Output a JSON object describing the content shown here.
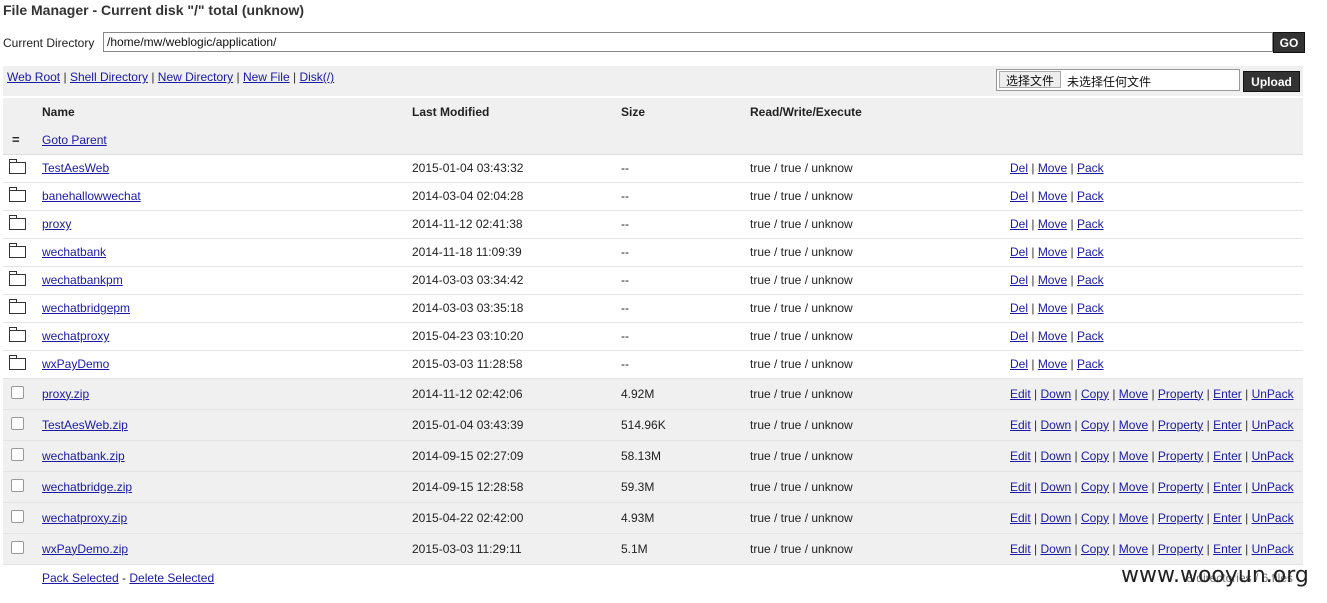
{
  "title": "File Manager - Current disk \"/\" total (unknow)",
  "current_directory": {
    "label": "Current Directory",
    "value": "/home/mw/weblogic/application/",
    "go_label": "GO"
  },
  "toolbar": {
    "links": [
      "Web Root",
      "Shell Directory",
      "New Directory",
      "New File",
      "Disk(/)"
    ],
    "choose_file_label": "选择文件",
    "no_file_text": "未选择任何文件",
    "upload_label": "Upload"
  },
  "table": {
    "headers": [
      "Name",
      "Last Modified",
      "Size",
      "Read/Write/Execute"
    ],
    "parent_symbol": "=",
    "parent_label": "Goto Parent",
    "dir_actions": [
      "Del",
      "Move",
      "Pack"
    ],
    "file_actions": [
      "Edit",
      "Down",
      "Copy",
      "Move",
      "Property",
      "Enter",
      "UnPack"
    ],
    "directories": [
      {
        "name": "TestAesWeb",
        "modified": "2015-01-04 03:43:32",
        "size": "--",
        "perms": "true / true / unknow"
      },
      {
        "name": "banehallowwechat",
        "modified": "2014-03-04 02:04:28",
        "size": "--",
        "perms": "true / true / unknow"
      },
      {
        "name": "proxy",
        "modified": "2014-11-12 02:41:38",
        "size": "--",
        "perms": "true / true / unknow"
      },
      {
        "name": "wechatbank",
        "modified": "2014-11-18 11:09:39",
        "size": "--",
        "perms": "true / true / unknow"
      },
      {
        "name": "wechatbankpm",
        "modified": "2014-03-03 03:34:42",
        "size": "--",
        "perms": "true / true / unknow"
      },
      {
        "name": "wechatbridgepm",
        "modified": "2014-03-03 03:35:18",
        "size": "--",
        "perms": "true / true / unknow"
      },
      {
        "name": "wechatproxy",
        "modified": "2015-04-23 03:10:20",
        "size": "--",
        "perms": "true / true / unknow"
      },
      {
        "name": "wxPayDemo",
        "modified": "2015-03-03 11:28:58",
        "size": "--",
        "perms": "true / true / unknow"
      }
    ],
    "files": [
      {
        "name": "proxy.zip",
        "modified": "2014-11-12 02:42:06",
        "size": "4.92M",
        "perms": "true / true / unknow"
      },
      {
        "name": "TestAesWeb.zip",
        "modified": "2015-01-04 03:43:39",
        "size": "514.96K",
        "perms": "true / true / unknow"
      },
      {
        "name": "wechatbank.zip",
        "modified": "2014-09-15 02:27:09",
        "size": "58.13M",
        "perms": "true / true / unknow"
      },
      {
        "name": "wechatbridge.zip",
        "modified": "2014-09-15 12:28:58",
        "size": "59.3M",
        "perms": "true / true / unknow"
      },
      {
        "name": "wechatproxy.zip",
        "modified": "2015-04-22 02:42:00",
        "size": "4.93M",
        "perms": "true / true / unknow"
      },
      {
        "name": "wxPayDemo.zip",
        "modified": "2015-03-03 11:29:11",
        "size": "5.1M",
        "perms": "true / true / unknow"
      }
    ],
    "footer": {
      "pack_selected": "Pack Selected",
      "delete_selected": "Delete Selected",
      "summary": "8 directories / 6 files"
    }
  },
  "watermark": "www.wooyun.org",
  "icons": {
    "directory": "folder-icon",
    "file": "checkbox"
  }
}
